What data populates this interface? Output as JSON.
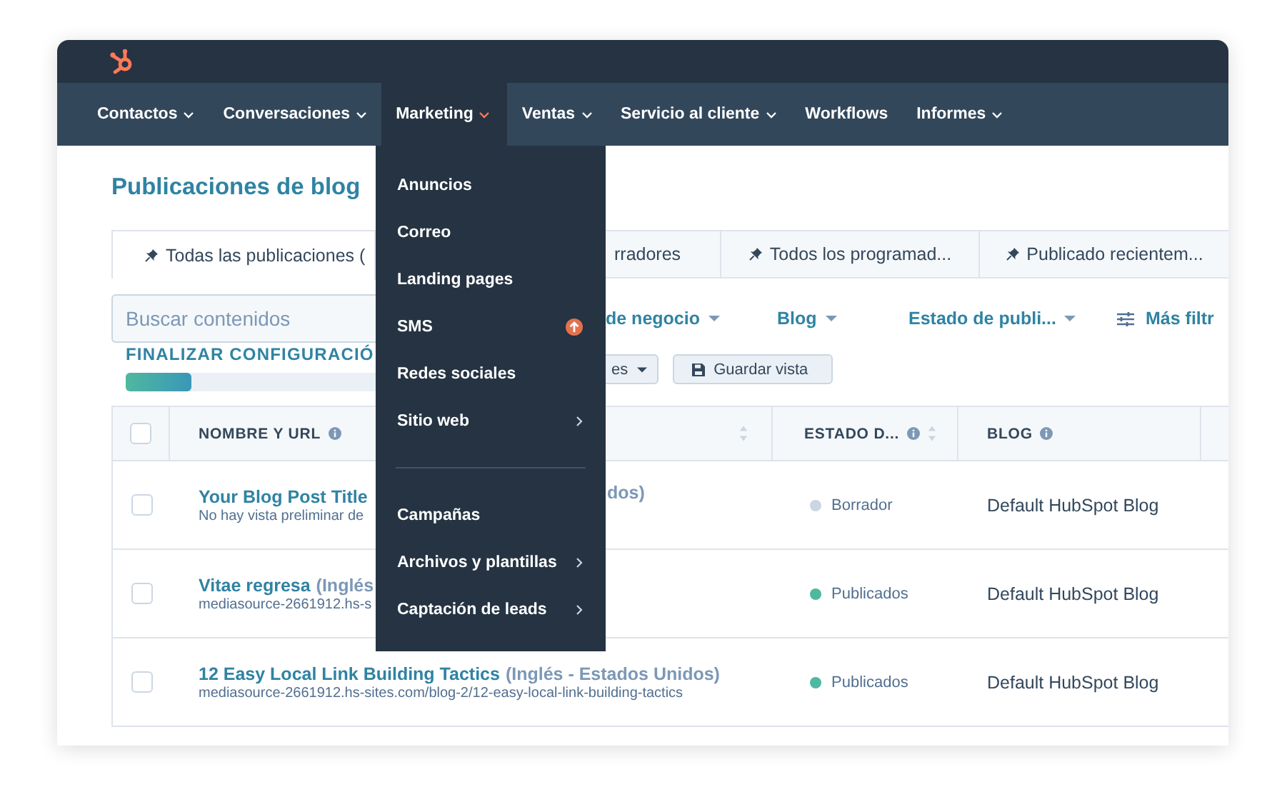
{
  "nav": [
    {
      "label": "Contactos",
      "caret": true,
      "selected": false
    },
    {
      "label": "Conversaciones",
      "caret": true,
      "selected": false
    },
    {
      "label": "Marketing",
      "caret": true,
      "selected": true
    },
    {
      "label": "Ventas",
      "caret": true,
      "selected": false
    },
    {
      "label": "Servicio al cliente",
      "caret": true,
      "selected": false
    },
    {
      "label": "Workflows",
      "caret": false,
      "selected": false
    },
    {
      "label": "Informes",
      "caret": true,
      "selected": false
    }
  ],
  "menu": [
    {
      "kind": "item",
      "label": "Anuncios",
      "submenu": false,
      "badge": false
    },
    {
      "kind": "item",
      "label": "Correo",
      "submenu": false,
      "badge": false
    },
    {
      "kind": "item",
      "label": "Landing pages",
      "submenu": false,
      "badge": false
    },
    {
      "kind": "item",
      "label": "SMS",
      "submenu": false,
      "badge": true
    },
    {
      "kind": "item",
      "label": "Redes sociales",
      "submenu": false,
      "badge": false
    },
    {
      "kind": "item",
      "label": "Sitio web",
      "submenu": true,
      "badge": false
    },
    {
      "kind": "divider"
    },
    {
      "kind": "item",
      "label": "Campañas",
      "submenu": false,
      "badge": false
    },
    {
      "kind": "item",
      "label": "Archivos y plantillas",
      "submenu": true,
      "badge": false
    },
    {
      "kind": "item",
      "label": "Captación de leads",
      "submenu": true,
      "badge": false
    }
  ],
  "page_title": "Publicaciones de blog",
  "tabs": [
    {
      "label": "Todas las publicaciones (",
      "selected": true,
      "pinned": true
    },
    {
      "label": "rradores",
      "selected": false,
      "pinned": false
    },
    {
      "label": "Todos los programad...",
      "selected": false,
      "pinned": true
    },
    {
      "label": "Publicado recientem...",
      "selected": false,
      "pinned": true
    }
  ],
  "search": {
    "placeholder": "Buscar contenidos"
  },
  "filters": [
    {
      "label": "de negocio",
      "kind": "dropdown"
    },
    {
      "label": "Blog",
      "kind": "dropdown"
    },
    {
      "label": "Estado de publi...",
      "kind": "dropdown"
    },
    {
      "label": "Más filtr",
      "kind": "more"
    }
  ],
  "setup": {
    "label": "FINALIZAR CONFIGURACIÓ",
    "level": 0.26
  },
  "view_buttons": [
    {
      "label": "es",
      "kind": "dropdown"
    },
    {
      "label": "Guardar vista",
      "kind": "save"
    }
  ],
  "table": {
    "columns": [
      {
        "label": "NOMBRE Y URL",
        "info": true,
        "sort": true
      },
      {
        "label": "ESTADO D...",
        "info": true,
        "sort": true
      },
      {
        "label": "BLOG",
        "info": true,
        "sort": false
      }
    ],
    "header_checkbox": {
      "checked": false
    },
    "rows": [
      {
        "checked": false,
        "title": "Your Blog Post Title",
        "lang": "",
        "tail": "dos)",
        "sub": "No hay vista preliminar de",
        "status": "Borrador",
        "color": "#cbd6e2",
        "blog": "Default HubSpot Blog"
      },
      {
        "checked": false,
        "title": "Vitae regresa",
        "lang": "(Inglés",
        "tail": "",
        "sub": "mediasource-2661912.hs-s",
        "status": "Publicados",
        "color": "#4fb8a0",
        "blog": "Default HubSpot Blog"
      },
      {
        "checked": false,
        "title": "12 Easy Local Link Building Tactics",
        "lang": "(Inglés - Estados Unidos)",
        "tail": "",
        "sub": "mediasource-2661912.hs-sites.com/blog-2/12-easy-local-link-building-tactics",
        "status": "Publicados",
        "color": "#4fb8a0",
        "blog": "Default HubSpot Blog"
      }
    ]
  }
}
